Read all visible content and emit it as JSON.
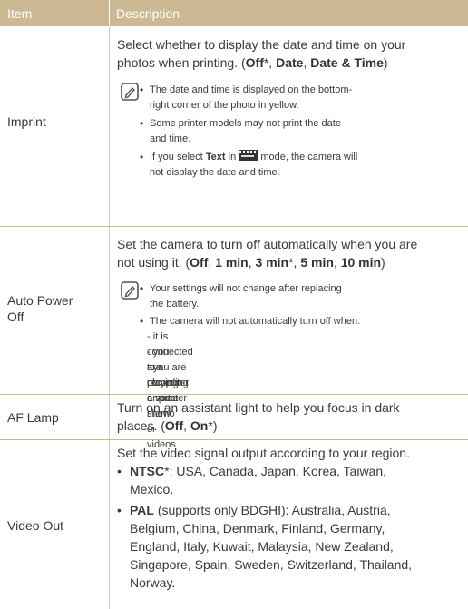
{
  "header": {
    "col_item": "Item",
    "col_description": "Description"
  },
  "imprint": {
    "label": "Imprint",
    "desc_line1": "Select whether to display the date and time on your",
    "desc_line2_a": "photos when printing. (",
    "opt_off": "Off",
    "star1": "*, ",
    "opt_date": "Date",
    "comma": ", ",
    "opt_date_time": "Date & Time",
    "close": ")",
    "notes": [
      "The date and time is displayed on the bottom-",
      "right corner of the photo in yellow.",
      "Some printer models may not print the date",
      "and time.",
      "If you select ",
      "Text",
      " in ",
      " mode, the camera will",
      "not display the date and time."
    ]
  },
  "auto_power_off": {
    "label_line1": "Auto Power",
    "label_line2": "Off",
    "desc_line1": "Set the camera to turn off automatically when you are",
    "desc_line2_a": "not using it. (",
    "opt_off": "Off",
    "c1": ", ",
    "opt_1min": "1 min",
    "c2": ", ",
    "opt_3min": "3 min",
    "star": "*, ",
    "opt_5min": "5 min",
    "c3": ", ",
    "opt_10min": "10 min",
    "close": ")",
    "notes": [
      "Your settings will not change after replacing",
      "the battery.",
      "The camera will not automatically turn off when:",
      "- it is connected to a computer or printer",
      "- you are playing a slide show or videos",
      "- you are recording a voice memo"
    ]
  },
  "af_lamp": {
    "label": "AF Lamp",
    "desc_line1": "Turn on an assistant light to help you focus in dark",
    "desc_line2_a": "places. (",
    "opt_off": "Off",
    "c1": ", ",
    "opt_on": "On",
    "star": "*)"
  },
  "video_out": {
    "label": "Video Out",
    "desc_line1": "Set the video signal output according to your region.",
    "ntsc": "NTSC",
    "ntsc_rest1": "*: USA, Canada, Japan, Korea, Taiwan,",
    "ntsc_rest2": "Mexico.",
    "pal": "PAL",
    "pal_line1": " (supports only BDGHI): Australia, Austria,",
    "pal_lines": [
      "Belgium, China, Denmark, Finland, Germany,",
      "England, Italy, Kuwait, Malaysia, New Zealand,",
      "Singapore, Spain, Sweden, Switzerland, Thailand,",
      "Norway."
    ]
  },
  "colors": {
    "header_bg": "#cdb894",
    "rule": "#cdb894",
    "text": "#3a3a3a"
  },
  "icons": {
    "note": "note-pencil-icon",
    "scene": "scene-mode-icon"
  }
}
